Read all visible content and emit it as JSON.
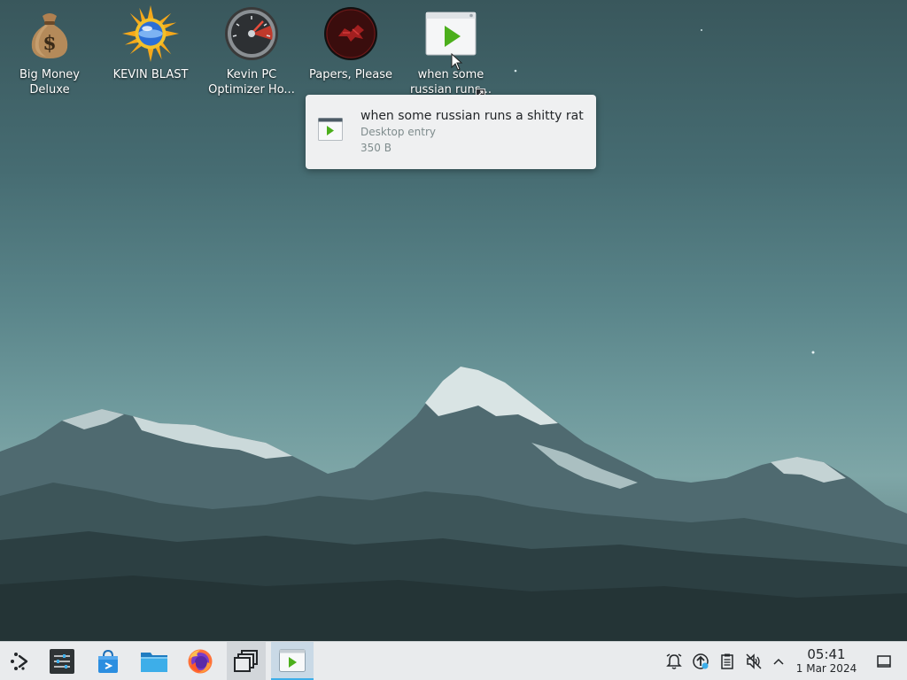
{
  "desktop": {
    "icons": [
      {
        "label_line1": "Big Money",
        "label_line2": "Deluxe",
        "icon": "money-bag-icon"
      },
      {
        "label_line1": "KEVIN BLAST",
        "label_line2": "",
        "icon": "sun-globe-icon"
      },
      {
        "label_line1": "Kevin PC",
        "label_line2": "Optimizer Ho...",
        "icon": "speedometer-icon"
      },
      {
        "label_line1": "Papers, Please",
        "label_line2": "",
        "icon": "papers-please-icon"
      },
      {
        "label_line1": "when some",
        "label_line2": "russian runs...",
        "icon": "desktop-entry-play-icon"
      }
    ]
  },
  "tooltip": {
    "title": "when some russian runs a shitty rat",
    "type": "Desktop entry",
    "size": "350 B",
    "icon": "desktop-entry-play-icon"
  },
  "taskbar": {
    "launchers": [
      {
        "name": "application-launcher",
        "icon": "kde-launcher-icon"
      },
      {
        "name": "system-settings",
        "icon": "settings-sliders-icon"
      },
      {
        "name": "discover",
        "icon": "store-bag-icon"
      },
      {
        "name": "dolphin-file-manager",
        "icon": "folder-icon"
      },
      {
        "name": "firefox",
        "icon": "firefox-icon"
      },
      {
        "name": "overview",
        "icon": "windows-stack-icon"
      },
      {
        "name": "running-desktop-entry",
        "icon": "desktop-entry-play-icon"
      }
    ],
    "tray": [
      {
        "name": "notifications",
        "icon": "bell-icon"
      },
      {
        "name": "updates",
        "icon": "update-arrow-icon"
      },
      {
        "name": "clipboard",
        "icon": "clipboard-icon"
      },
      {
        "name": "volume",
        "icon": "speaker-muted-icon"
      },
      {
        "name": "expand-tray",
        "icon": "chevron-up-icon"
      }
    ],
    "clock": {
      "time": "05:41",
      "date": "1 Mar 2024"
    },
    "show_desktop_icon": "show-desktop-icon"
  },
  "colors": {
    "accent": "#3daee9",
    "tooltip_bg": "#eff0f1",
    "taskbar_bg": "#e9ebed",
    "play_green": "#4caf1c"
  }
}
